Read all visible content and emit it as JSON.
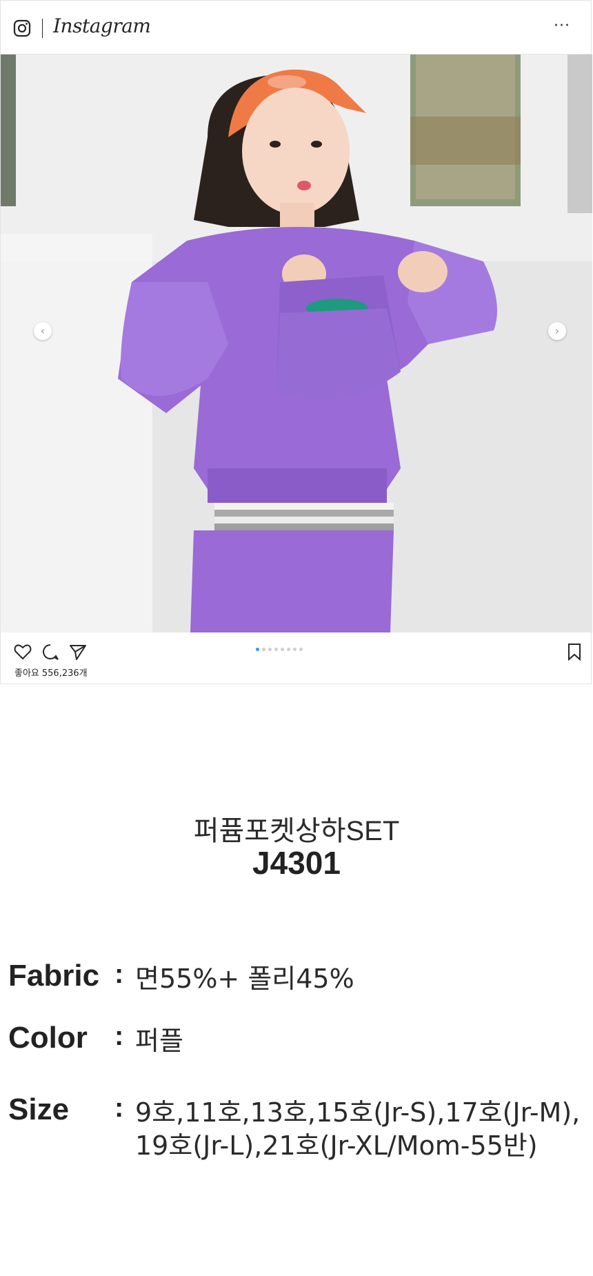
{
  "instagram": {
    "brand": "Instagram",
    "more_label": "···",
    "likes_label": "좋아요",
    "likes_count": "556,236개",
    "carousel": {
      "total": 8,
      "active_index": 0,
      "prev_label": "‹",
      "next_label": "›"
    }
  },
  "product": {
    "name": "퍼퓸포켓상하SET",
    "code": "J4301",
    "specs": {
      "fabric_label": "Fabric",
      "fabric_value": "면55%+ 폴리45%",
      "color_label": "Color",
      "color_value": "퍼플",
      "size_label": "Size",
      "size_value_line1": "9호,11호,13호,15호(Jr-S),17호(Jr-M),",
      "size_value_line2": "19호(Jr-L),21호(Jr-XL/Mom-55반)",
      "colon": ":"
    }
  },
  "colors": {
    "sweatshirt": "#9a6ad6",
    "cap": "#f07a45",
    "pouch": "#1e9a7e",
    "active_dot": "#3897f0"
  }
}
